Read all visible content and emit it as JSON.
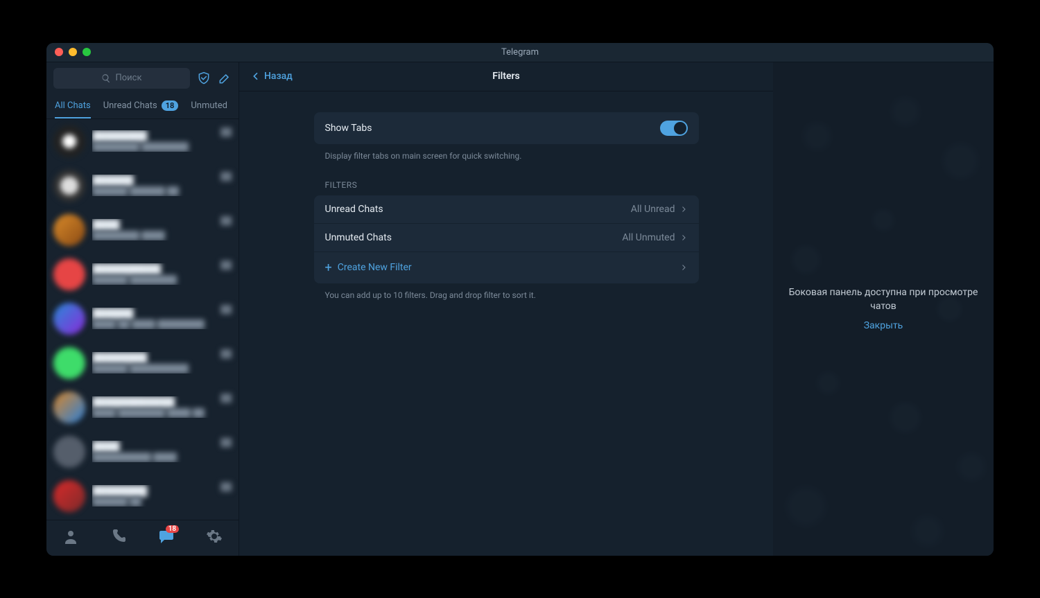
{
  "window": {
    "title": "Telegram"
  },
  "sidebar": {
    "search_placeholder": "Поиск",
    "tabs": [
      {
        "label": "All Chats",
        "active": true
      },
      {
        "label": "Unread Chats",
        "badge": "18"
      },
      {
        "label": "Unmuted"
      }
    ],
    "bottom_badge": "18"
  },
  "main": {
    "back_label": "Назад",
    "title": "Filters",
    "show_tabs_label": "Show Tabs",
    "show_tabs_hint": "Display filter tabs on main screen for quick switching.",
    "filters_section": "FILTERS",
    "filters": [
      {
        "name": "Unread Chats",
        "value": "All Unread"
      },
      {
        "name": "Unmuted Chats",
        "value": "All Unmuted"
      }
    ],
    "create_label": "Create New Filter",
    "footer_hint": "You can add up to 10 filters. Drag and drop filter to sort it."
  },
  "right": {
    "message": "Боковая панель доступна при просмотре чатов",
    "close": "Закрыть"
  }
}
